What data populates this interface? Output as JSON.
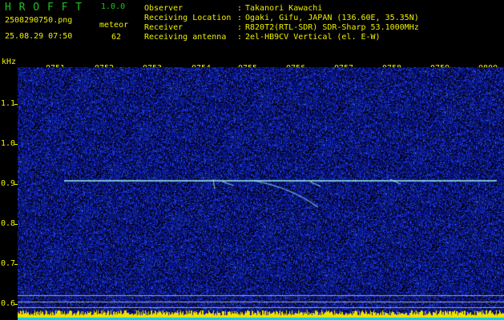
{
  "header": {
    "app_title": "H R O F F T",
    "app_version": "1.0.0",
    "file_name": "2508290750.png",
    "capture_time": "25.08.29 07:50",
    "mode_label": "meteor",
    "count_value": "62",
    "info": [
      {
        "label": "Observer",
        "value": "Takanori Kawachi"
      },
      {
        "label": "Receiving Location",
        "value": "Ogaki, Gifu, JAPAN (136.60E, 35.35N)"
      },
      {
        "label": "Receiver",
        "value": "R820T2(RTL-SDR) SDR-Sharp 53.1000MHz"
      },
      {
        "label": "Receiving antenna",
        "value": "2el-HB9CV Vertical (el. E-W)"
      }
    ]
  },
  "axis": {
    "unit": "kHz",
    "time_ticks": [
      "0751",
      "0752",
      "0753",
      "0754",
      "0755",
      "0756",
      "0757",
      "0758",
      "0759",
      "0800"
    ],
    "freq_ticks": [
      "1.1",
      "1.0",
      "0.9",
      "0.8",
      "0.7",
      "0.6"
    ]
  },
  "colors": {
    "text": "#f0f000",
    "title": "#20c020",
    "background_noise": "#1a2a8a",
    "carrier": "#a0f0f0",
    "level_bar": "#f0e000"
  }
}
